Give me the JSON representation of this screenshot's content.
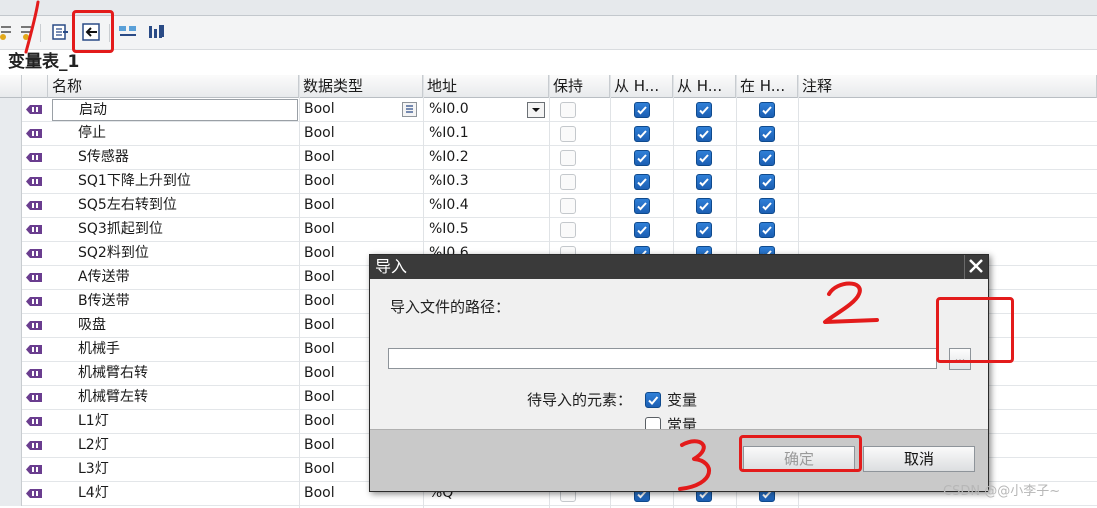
{
  "toolbar": {
    "icons": [
      "insert-row-icon",
      "add-row-icon",
      "export-icon",
      "import-icon",
      "monitor-icon",
      "tag-table-icon"
    ]
  },
  "table": {
    "title": "变量表_1",
    "columns": {
      "name": "名称",
      "data_type": "数据类型",
      "address": "地址",
      "retain": "保持",
      "from_hmi": "从 H...",
      "from_hmi2": "从 H...",
      "in_hmi": "在 H...",
      "comment": "注释"
    },
    "rows": [
      {
        "name": "启动",
        "type": "Bool",
        "address": "%I0.0"
      },
      {
        "name": "停止",
        "type": "Bool",
        "address": "%I0.1"
      },
      {
        "name": "S传感器",
        "type": "Bool",
        "address": "%I0.2"
      },
      {
        "name": "SQ1下降上升到位",
        "type": "Bool",
        "address": "%I0.3"
      },
      {
        "name": "SQ5左右转到位",
        "type": "Bool",
        "address": "%I0.4"
      },
      {
        "name": "SQ3抓起到位",
        "type": "Bool",
        "address": "%I0.5"
      },
      {
        "name": "SQ2料到位",
        "type": "Bool",
        "address": "%I0.6"
      },
      {
        "name": "A传送带",
        "type": "Bool",
        "address": ""
      },
      {
        "name": "B传送带",
        "type": "Bool",
        "address": ""
      },
      {
        "name": "吸盘",
        "type": "Bool",
        "address": ""
      },
      {
        "name": "机械手",
        "type": "Bool",
        "address": ""
      },
      {
        "name": "机械臂右转",
        "type": "Bool",
        "address": ""
      },
      {
        "name": "机械臂左转",
        "type": "Bool",
        "address": ""
      },
      {
        "name": "L1灯",
        "type": "Bool",
        "address": ""
      },
      {
        "name": "L2灯",
        "type": "Bool",
        "address": ""
      },
      {
        "name": "L3灯",
        "type": "Bool",
        "address": ""
      },
      {
        "name": "L4灯",
        "type": "Bool",
        "address": "%Q"
      }
    ]
  },
  "dialog": {
    "title": "导入",
    "path_label": "导入文件的路径：",
    "path_value": "",
    "browse_label": "...",
    "elements_label": "待导入的元素：",
    "options": [
      {
        "label": "变量",
        "checked": true
      },
      {
        "label": "常量",
        "checked": false
      }
    ],
    "ok_label": "确定",
    "cancel_label": "取消"
  },
  "annotations": {
    "step1": "1",
    "step2": "2",
    "step3": "3",
    "color": "#e31b1b"
  },
  "watermark": "CSDN @@小李子~",
  "colors": {
    "checkbox_blue": "#1c5fb3",
    "tag_icon": "#6a3d8f",
    "dialog_title": "#3a3a3a"
  }
}
